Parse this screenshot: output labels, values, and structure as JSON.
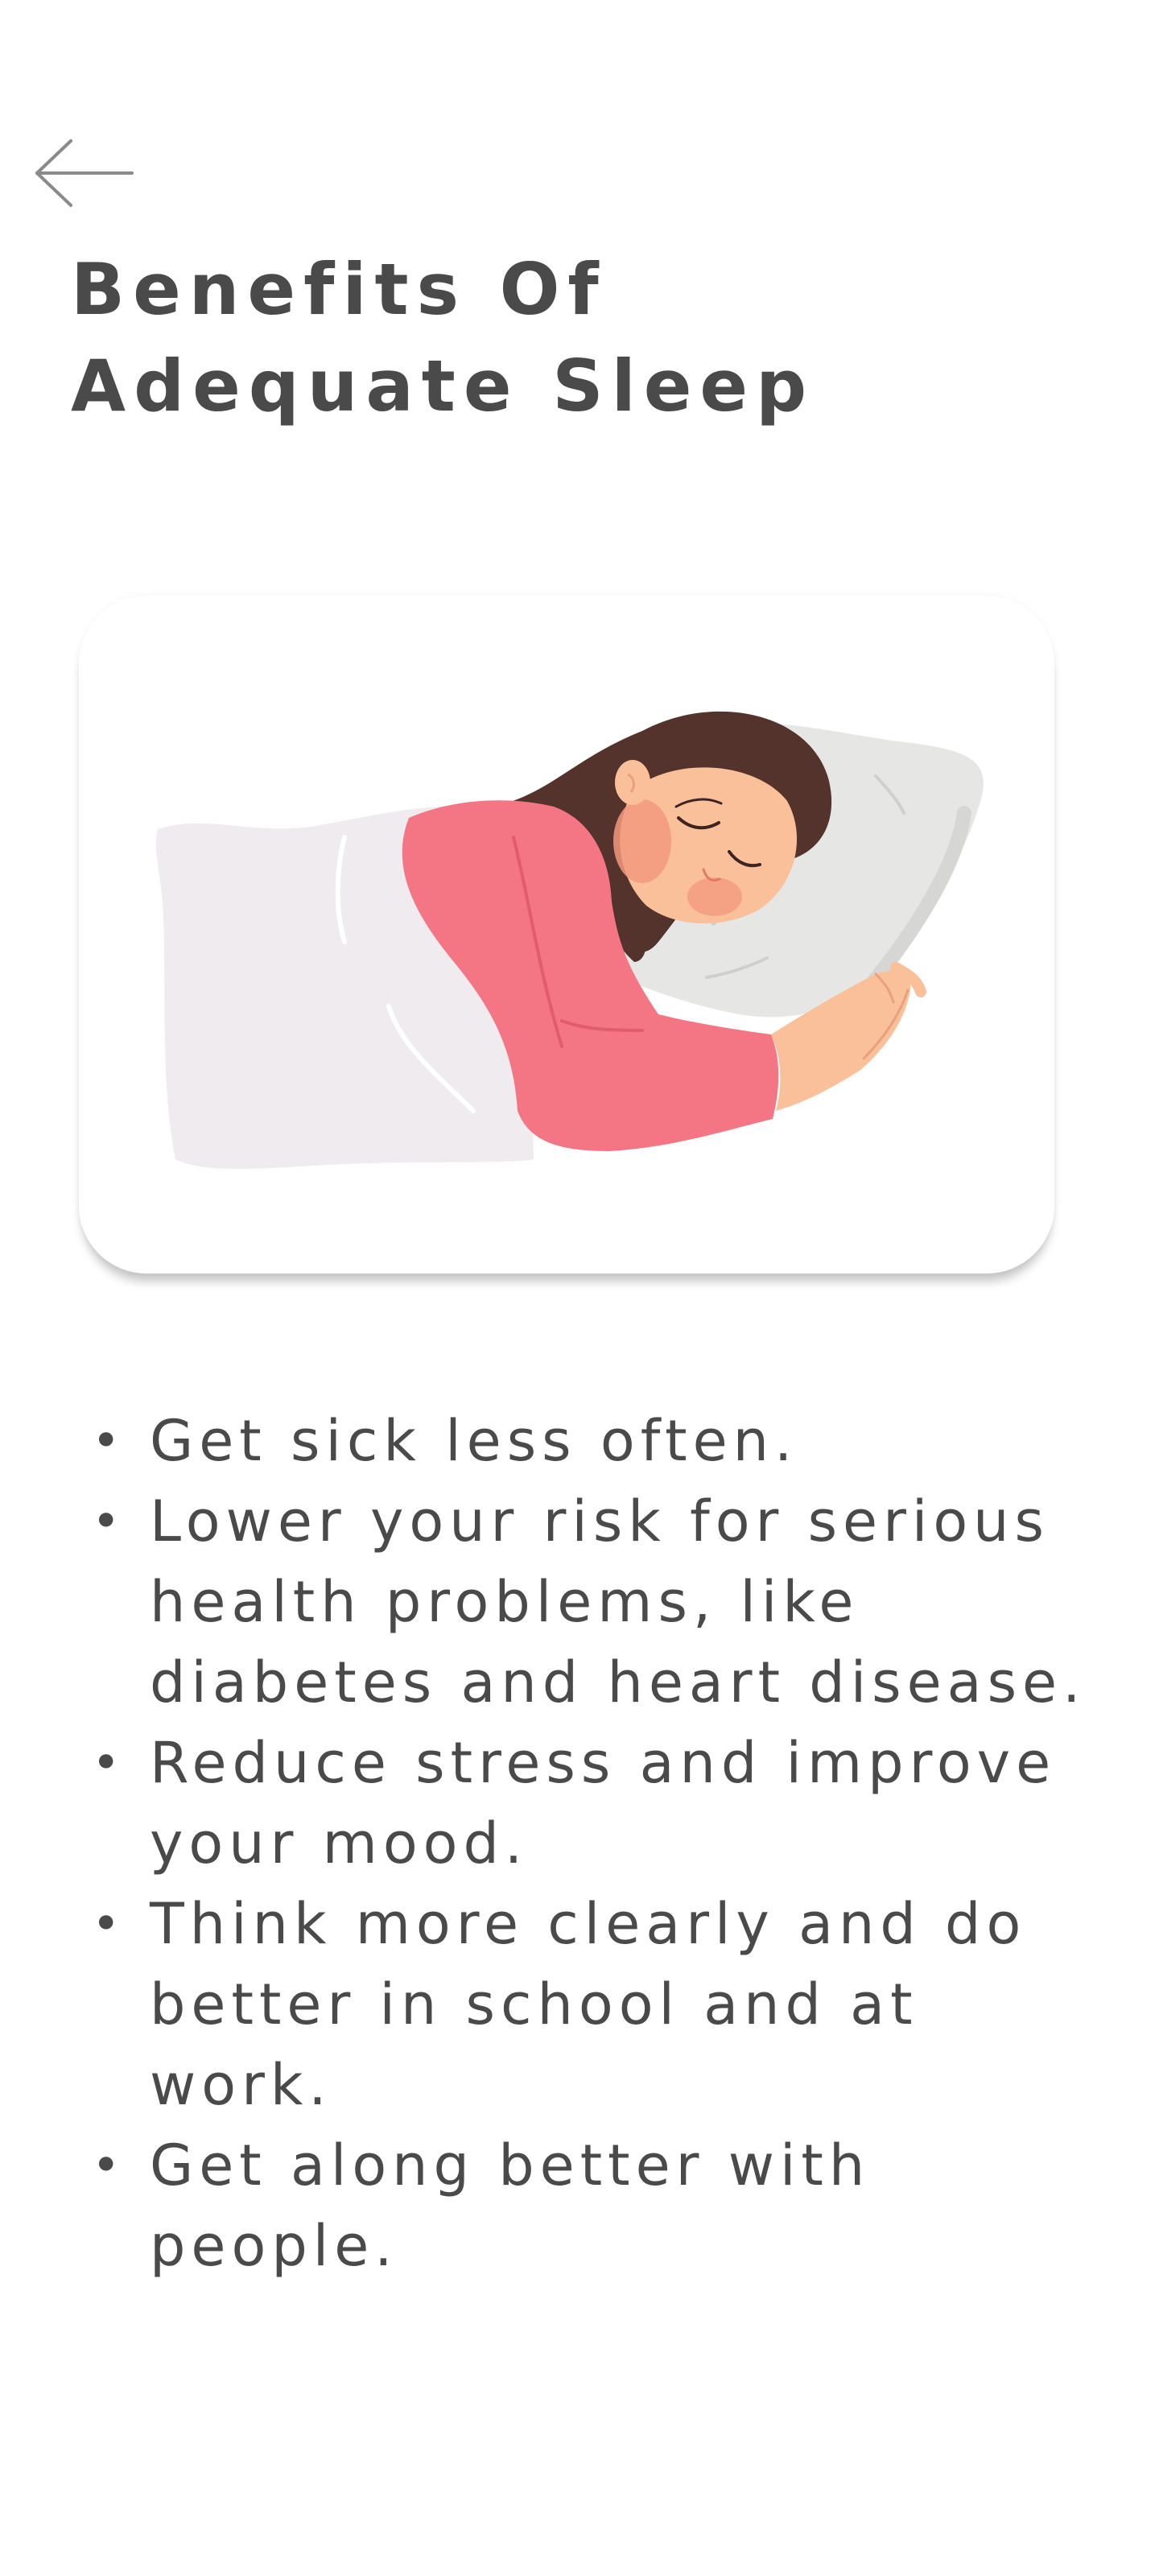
{
  "header": {
    "back_icon": "arrow-left-icon",
    "title": "Benefits Of Adequate Sleep"
  },
  "illustration": {
    "subject": "woman-sleeping-illustration",
    "colors": {
      "hair": "#53332b",
      "shirt": "#f47583",
      "skin": "#f9c09a",
      "cheek": "#f4997e",
      "pillow": "#e6e7e5",
      "blanket": "#efebee"
    }
  },
  "benefits": {
    "bullet": "•",
    "items": [
      "Get sick less often.",
      "Lower your risk for serious health problems, like diabetes and heart disease.",
      "Reduce stress and improve your mood.",
      "Think more clearly and do better in school and at work.",
      "Get along better with people."
    ]
  }
}
